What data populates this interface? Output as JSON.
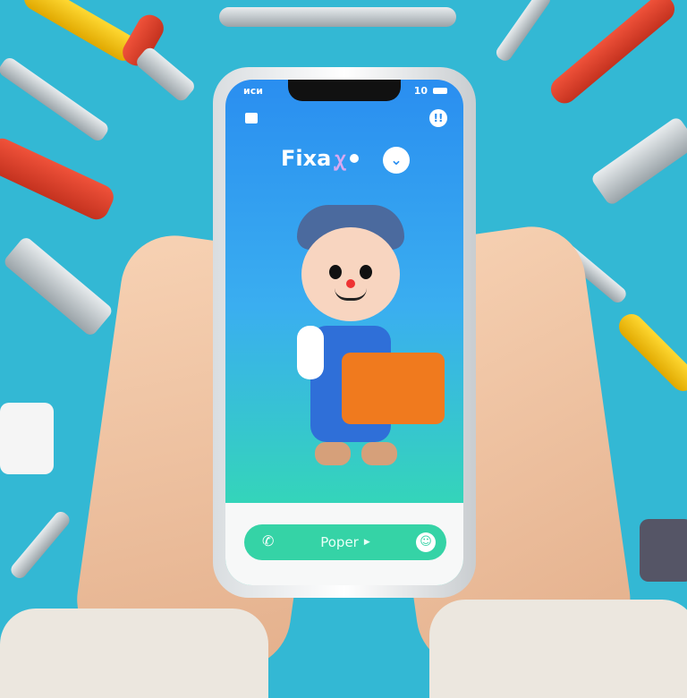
{
  "app": {
    "logo_text": "Fixa",
    "status_bar": {
      "left": "ᴎᴄᴎ",
      "right": "10"
    },
    "icons": {
      "top_left": "toolbox-icon",
      "top_right": "info-icon",
      "logo_badge": "chevron-down-icon"
    },
    "cta": {
      "label": "Poper",
      "left_icon": "phone-icon",
      "right_icon": "smiley-icon"
    }
  },
  "colors": {
    "background": "#33b8d4",
    "screen_top": "#2a8ef0",
    "screen_bottom": "#34d6b8",
    "cta": "#35d3a6",
    "toolbox": "#f07a1e"
  }
}
